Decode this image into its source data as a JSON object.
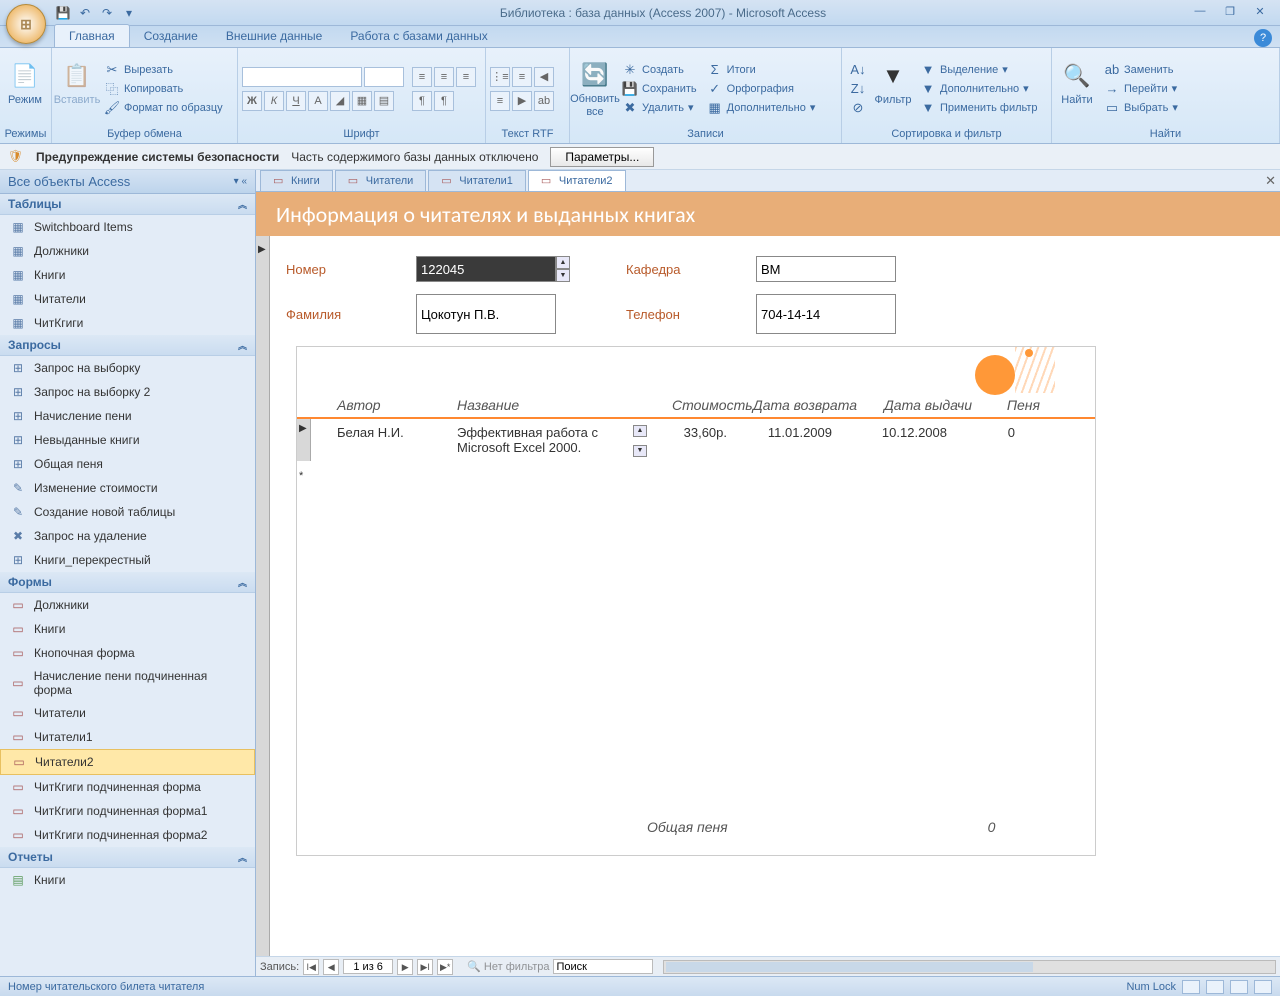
{
  "title": "Библиотека : база данных (Access 2007) - Microsoft Access",
  "ribbon_tabs": [
    "Главная",
    "Создание",
    "Внешние данные",
    "Работа с базами данных"
  ],
  "ribbon": {
    "groups": {
      "rezhimy": "Режимы",
      "rezhim": "Режим",
      "bufer": "Буфер обмена",
      "vstavit": "Вставить",
      "vyrezat": "Вырезать",
      "kopirovat": "Копировать",
      "format": "Формат по образцу",
      "shrift": "Шрифт",
      "tekst": "Текст RTF",
      "zapisi": "Записи",
      "obnovit": "Обновить\nвсе",
      "sozdat": "Создать",
      "sohranit": "Сохранить",
      "udalit": "Удалить",
      "itogi": "Итоги",
      "orfo": "Орфография",
      "dop": "Дополнительно",
      "sortfilter": "Сортировка и фильтр",
      "filter": "Фильтр",
      "vydel": "Выделение",
      "dop2": "Дополнительно",
      "primenit": "Применить фильтр",
      "naiti_grp": "Найти",
      "naiti": "Найти",
      "zamenit": "Заменить",
      "pereiti": "Перейти",
      "vybrat": "Выбрать"
    }
  },
  "security": {
    "warn": "Предупреждение системы безопасности",
    "msg": "Часть содержимого базы данных отключено",
    "btn": "Параметры..."
  },
  "nav": {
    "header": "Все объекты Access",
    "sections": {
      "tables": "Таблицы",
      "queries": "Запросы",
      "forms": "Формы",
      "reports": "Отчеты"
    },
    "tables": [
      "Switchboard Items",
      "Должники",
      "Книги",
      "Читатели",
      "ЧитКгиги"
    ],
    "queries": [
      "Запрос на выборку",
      "Запрос на выборку 2",
      "Начисление пени",
      "Невыданные книги",
      "Общая пеня",
      "Изменение стоимости",
      "Создание новой таблицы",
      "Запрос на удаление",
      "Книги_перекрестный"
    ],
    "forms": [
      "Должники",
      "Книги",
      "Кнопочная форма",
      "Начисление пени подчиненная форма",
      "Читатели",
      "Читатели1",
      "Читатели2",
      "ЧитКгиги подчиненная форма",
      "ЧитКгиги подчиненная форма1",
      "ЧитКгиги подчиненная форма2"
    ],
    "reports": [
      "Книги"
    ]
  },
  "doctabs": [
    "Книги",
    "Читатели",
    "Читатели1",
    "Читатели2"
  ],
  "form": {
    "title": "Информация о читателях и выданных книгах",
    "labels": {
      "nomer": "Номер",
      "familia": "Фамилия",
      "kafedra": "Кафедра",
      "telefon": "Телефон"
    },
    "values": {
      "nomer": "122045",
      "familia": "Цокотун П.В.",
      "kafedra": "ВМ",
      "telefon": "704-14-14"
    },
    "sub": {
      "cols": {
        "author": "Автор",
        "title": "Название",
        "cost": "Стоимость",
        "return": "Дата возврата",
        "issue": "Дата выдачи",
        "fine": "Пеня"
      },
      "row": {
        "author": "Белая Н.И.",
        "title": "Эффективная работа с Microsoft Excel 2000.",
        "cost": "33,60р.",
        "return": "11.01.2009",
        "issue": "10.12.2008",
        "fine": "0"
      },
      "footer": {
        "label": "Общая пеня",
        "value": "0"
      }
    }
  },
  "recnav": {
    "label": "Запись:",
    "pos": "1 из 6",
    "nofilter": "Нет фильтра",
    "search": "Поиск"
  },
  "status": {
    "left": "Номер читательского билета читателя",
    "numlock": "Num Lock"
  }
}
